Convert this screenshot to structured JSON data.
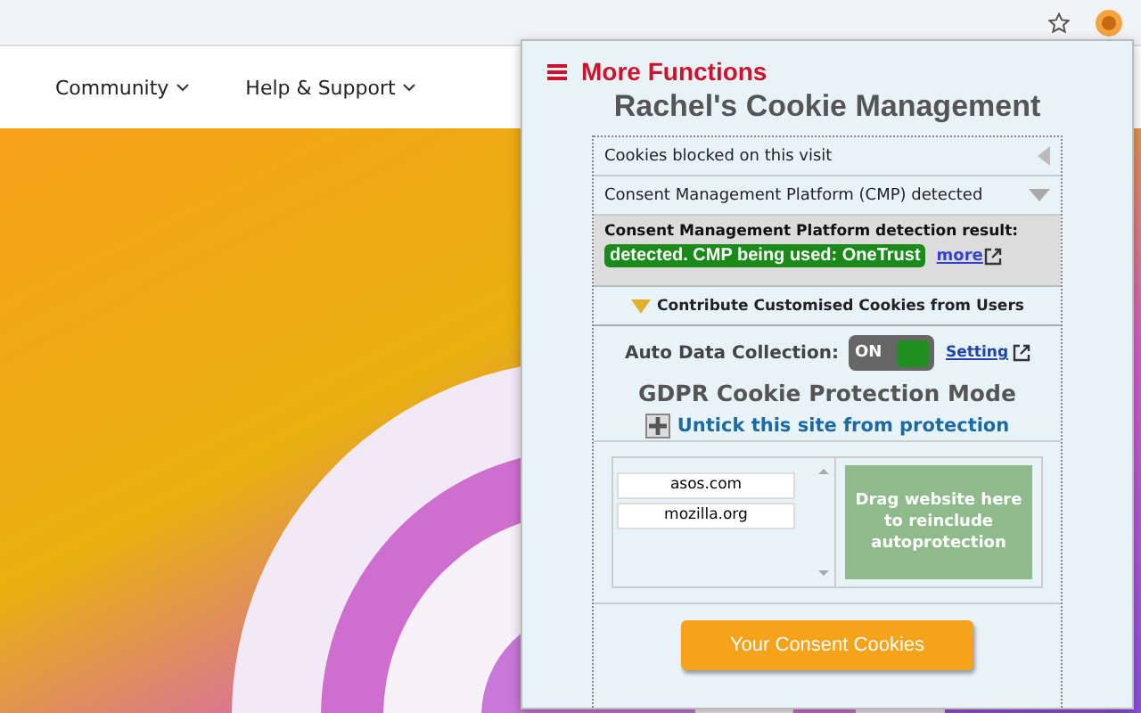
{
  "nav": [
    {
      "label": "Community"
    },
    {
      "label": "Help & Support"
    }
  ],
  "popup": {
    "menu_label": "More Functions",
    "title": "Rachel's Cookie Management",
    "sections": [
      {
        "label": "Cookies blocked on this visit",
        "expanded": false
      },
      {
        "label": "Consent Management Platform (CMP) detected",
        "expanded": true
      }
    ],
    "detection": {
      "heading": "Consent Management Platform detection result:",
      "result": "detected. CMP being used: OneTrust",
      "more_link": "more"
    },
    "contribute": {
      "label": "Contribute Customised Cookies from Users",
      "expanded": true
    },
    "auto_collection": {
      "label": "Auto Data Collection:",
      "on": true,
      "toggle_text": "ON",
      "setting_link": "Setting"
    },
    "mode_title": "GDPR Cookie Protection Mode",
    "untick_link": "Untick this site from protection",
    "sites": [
      "asos.com",
      "mozilla.org"
    ],
    "drop_zone": "Drag website here to reinclude autoprotection",
    "button": "Your Consent Cookies"
  }
}
